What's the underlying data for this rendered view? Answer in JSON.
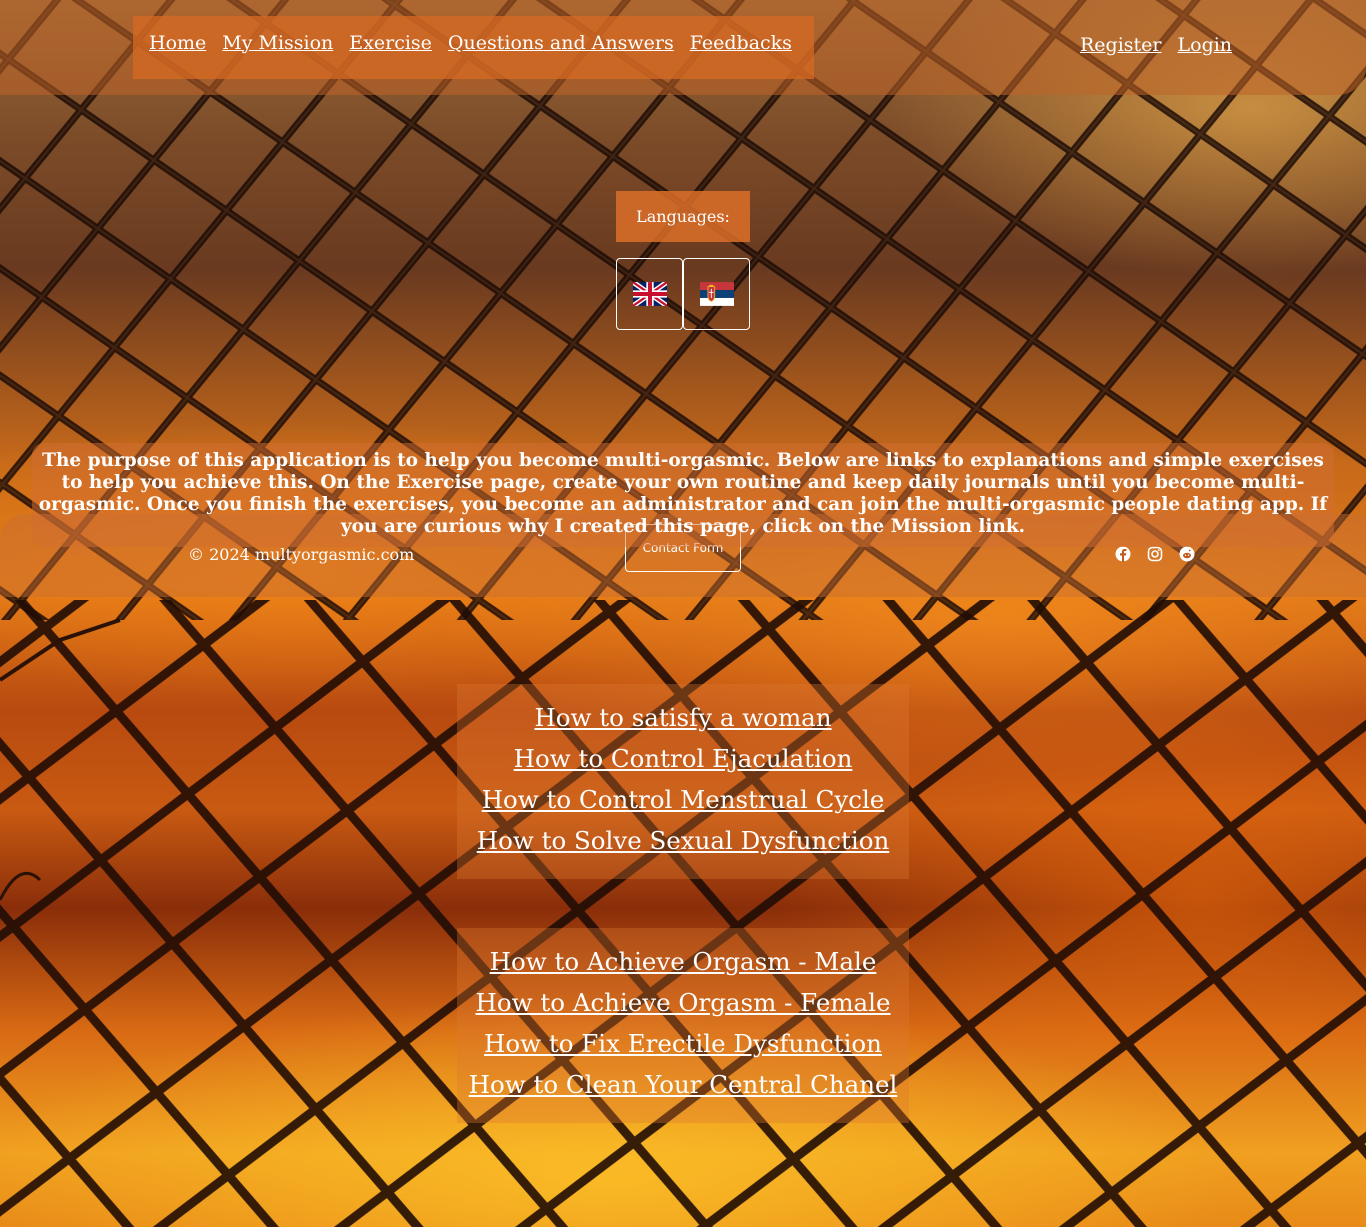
{
  "nav": {
    "items": [
      {
        "label": "Home"
      },
      {
        "label": "My Mission"
      },
      {
        "label": "Exercise"
      },
      {
        "label": "Questions and Answers"
      },
      {
        "label": "Feedbacks"
      }
    ]
  },
  "auth": {
    "register_label": "Register",
    "login_label": "Login"
  },
  "languages": {
    "label": "Languages:",
    "options": [
      {
        "name": "English",
        "icon": "uk-flag-icon"
      },
      {
        "name": "Serbian",
        "icon": "serbia-flag-icon"
      }
    ]
  },
  "intro": {
    "text": "The purpose of this application is to help you become multi-orgasmic. Below are links to explanations and simple exercises to help you achieve this. On the Exercise page, create your own routine and keep daily journals until you become multi-orgasmic. Once you finish the exercises, you become an administrator and can join the multi-orgasmic people dating app. If you are curious why I created this page, click on the Mission link."
  },
  "footer": {
    "copyright": "© 2024 multyorgasmic.com",
    "contact_label": "Contact Form",
    "social": [
      {
        "icon": "facebook-icon"
      },
      {
        "icon": "instagram-icon"
      },
      {
        "icon": "reddit-icon"
      }
    ]
  },
  "guides": {
    "group1": [
      {
        "label": "How to satisfy a woman"
      },
      {
        "label": "How to Control Ejaculation"
      },
      {
        "label": "How to Control Menstrual Cycle"
      },
      {
        "label": "How to Solve Sexual Dysfunction"
      }
    ],
    "group2": [
      {
        "label": "How to Achieve Orgasm - Male"
      },
      {
        "label": "How to Achieve Orgasm - Female"
      },
      {
        "label": "How to Fix Erectile Dysfunction"
      },
      {
        "label": "How to Clean Your Central Chanel"
      }
    ]
  }
}
